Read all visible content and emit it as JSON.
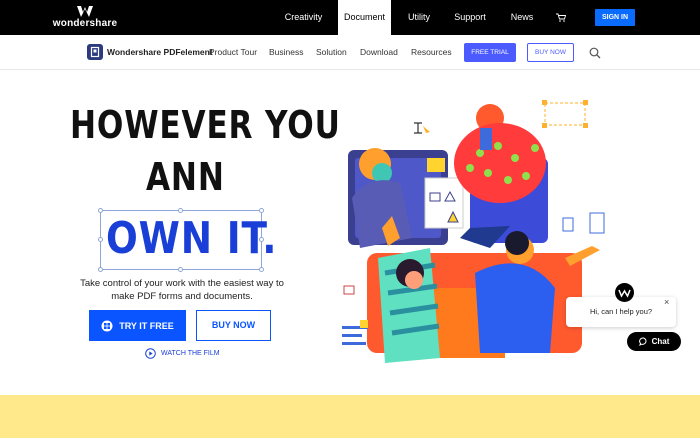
{
  "topbar": {
    "brand": "wondershare",
    "nav": [
      {
        "label": "Creativity",
        "active": false
      },
      {
        "label": "Document",
        "active": true
      },
      {
        "label": "Utility",
        "active": false
      },
      {
        "label": "Support",
        "active": false
      },
      {
        "label": "News",
        "active": false
      }
    ],
    "signin_label": "SIGN IN"
  },
  "subbar": {
    "product_name": "Wondershare PDFelement",
    "nav": [
      "Product Tour",
      "Business",
      "Solution",
      "Download",
      "Resources"
    ],
    "trial_label": "FREE TRIAL",
    "buy_label": "BUY NOW"
  },
  "hero": {
    "line1": "HOWEVER YOU",
    "line2": "ANN",
    "line3": "OWN IT.",
    "description": "Take control of your work with the easiest way to make PDF forms and documents.",
    "try_label": "TRY IT FREE",
    "buy_label": "BUY NOW",
    "watch_label": "WATCH THE FILM"
  },
  "chat": {
    "message": "Hi, can I help you?",
    "close": "×",
    "button_label": "Chat"
  },
  "colors": {
    "accent": "#0a55ff",
    "subbar_accent": "#4c5bff",
    "topbar_bg": "#000000",
    "footer_band": "#ffe98a"
  }
}
